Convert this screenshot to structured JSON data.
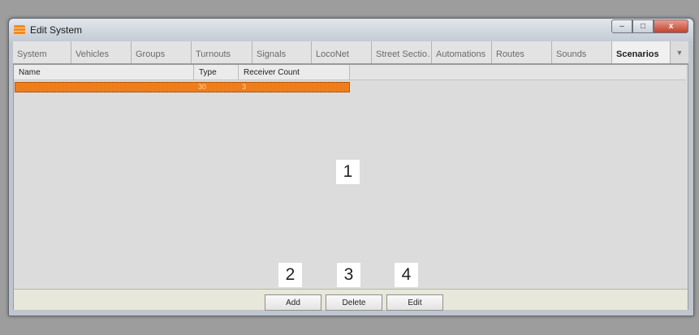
{
  "window": {
    "title": "Edit System",
    "buttons": {
      "minimize": "–",
      "maximize": "□",
      "close": "x"
    }
  },
  "tabs": [
    {
      "label": "System",
      "active": false
    },
    {
      "label": "Vehicles",
      "active": false
    },
    {
      "label": "Groups",
      "active": false
    },
    {
      "label": "Turnouts",
      "active": false
    },
    {
      "label": "Signals",
      "active": false
    },
    {
      "label": "LocoNet",
      "active": false
    },
    {
      "label": "Street Sectio…",
      "active": false
    },
    {
      "label": "Automations",
      "active": false
    },
    {
      "label": "Routes",
      "active": false
    },
    {
      "label": "Sounds",
      "active": false
    },
    {
      "label": "Scenarios",
      "active": true
    }
  ],
  "tab_overflow_icon": "▼",
  "grid": {
    "columns": [
      "Name",
      "Type",
      "Receiver Count"
    ],
    "rows": [
      {
        "name": "",
        "type": "30",
        "receiver_count": "3"
      }
    ]
  },
  "footer": {
    "add_label": "Add",
    "delete_label": "Delete",
    "edit_label": "Edit"
  },
  "callouts": [
    "1",
    "2",
    "3",
    "4"
  ],
  "colors": {
    "selected_row": "#ee7d1a",
    "close_button": "#c0432d",
    "app_icon": "#f08a22"
  }
}
